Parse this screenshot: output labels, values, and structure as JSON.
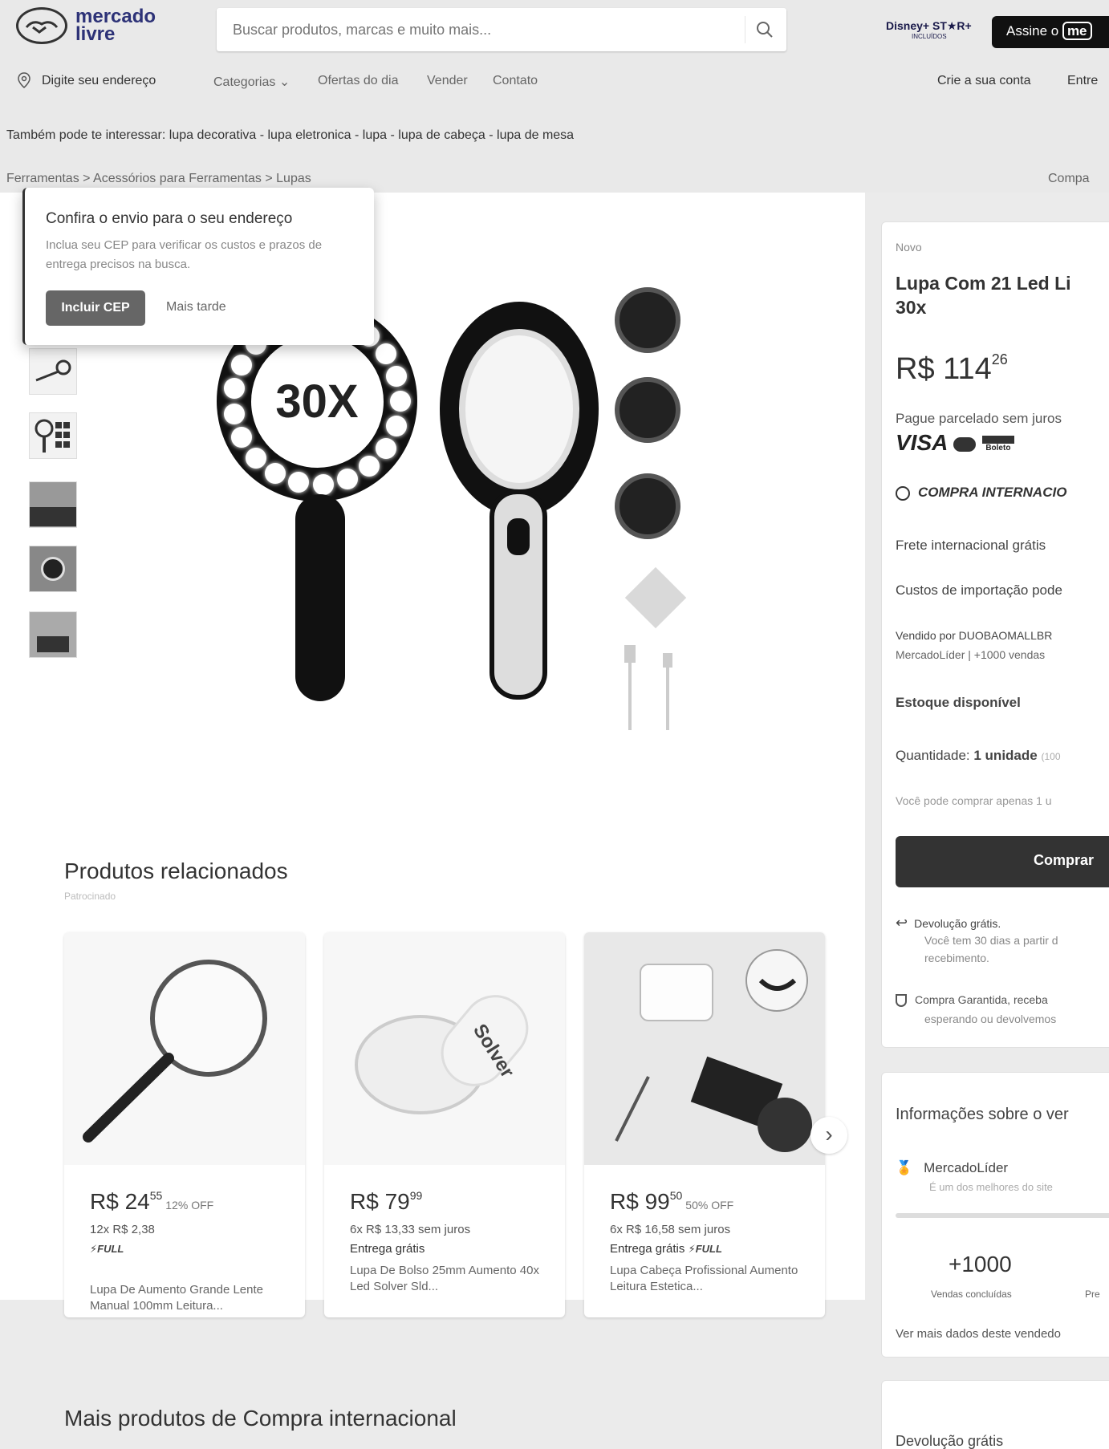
{
  "header": {
    "logo_text": "mercado\nlivre",
    "search_placeholder": "Buscar produtos, marcas e muito mais...",
    "disney_label": "Disney+ ST★R+",
    "disney_sub": "INCLUÍDOS",
    "subscribe_label": "Assine o",
    "subscribe_badge": "me"
  },
  "nav": {
    "address": "Digite seu endereço",
    "categories": "Categorias",
    "offers": "Ofertas do dia",
    "sell": "Vender",
    "contact": "Contato",
    "create_account": "Crie a sua conta",
    "enter": "Entre"
  },
  "interest": "Também pode te interessar: lupa decorativa - lupa eletronica - lupa - lupa de cabeça - lupa de mesa",
  "breadcrumb": "Ferramentas > Acessórios para Ferramentas > Lupas",
  "share": "Compa",
  "popup": {
    "title": "Confira o envio para o seu endereço",
    "body": "Inclua seu CEP para verificar os custos e prazos de entrega precisos na busca.",
    "primary": "Incluir CEP",
    "secondary": "Mais tarde"
  },
  "product_image_text": "30X",
  "product": {
    "condition": "Novo",
    "title_line1": "Lupa Com 21 Led Li",
    "title_line2": "30x",
    "currency": "R$",
    "price_int": "114",
    "price_cents": "26",
    "installments": "Pague parcelado sem juros",
    "payment_visa": "VISA",
    "payment_boleto": "Boleto",
    "international": "COMPRA INTERNACIO",
    "shipping": "Frete internacional grátis",
    "import_costs": "Custos de importação pode",
    "sold_by": "Vendido por DUOBAOMALLBR",
    "seller_meta": "MercadoLíder  |  +1000 vendas",
    "stock": "Estoque disponível",
    "quantity_label": "Quantidade:",
    "quantity_value": "1 unidade",
    "quantity_avail": "(100",
    "limit_note": "Você pode comprar apenas 1 u",
    "buy_button": "Comprar",
    "returns_title": "Devolução grátis.",
    "returns_body1": "Você tem 30 dias a partir d",
    "returns_body2": "recebimento.",
    "guarantee1": "Compra Garantida, receba",
    "guarantee2": "esperando ou devolvemos"
  },
  "seller": {
    "title": "Informações sobre o ver",
    "badge": "MercadoLíder",
    "badge_desc": "É um dos melhores do site",
    "sales_value": "+1000",
    "sales_label": "Vendas concluídas",
    "pre_label": "Pre",
    "more_link": "Ver mais dados deste vendedo"
  },
  "related": {
    "title": "Produtos relacionados",
    "subtitle": "Patrocinado",
    "items": [
      {
        "price_int": "R$ 24",
        "cents": "55",
        "off": "12% OFF",
        "inst": "12x R$ 2,38",
        "ship": "",
        "full": "FULL",
        "name": "Lupa De Aumento Grande Lente Manual 100mm Leitura..."
      },
      {
        "price_int": "R$ 79",
        "cents": "99",
        "off": "",
        "inst": "6x R$ 13,33 sem juros",
        "ship": "Entrega grátis",
        "full": "",
        "name": "Lupa De Bolso 25mm Aumento 40x Led Solver Sld..."
      },
      {
        "price_int": "R$ 99",
        "cents": "50",
        "off": "50% OFF",
        "inst": "6x R$ 16,58 sem juros",
        "ship": "Entrega grátis",
        "full": "FULL",
        "name": "Lupa Cabeça Profissional Aumento Leitura Estetica..."
      }
    ],
    "solver_text": "Solver"
  },
  "more_title": "Mais produtos de Compra internacional",
  "bottom_panel_text": "Devolução grátis"
}
